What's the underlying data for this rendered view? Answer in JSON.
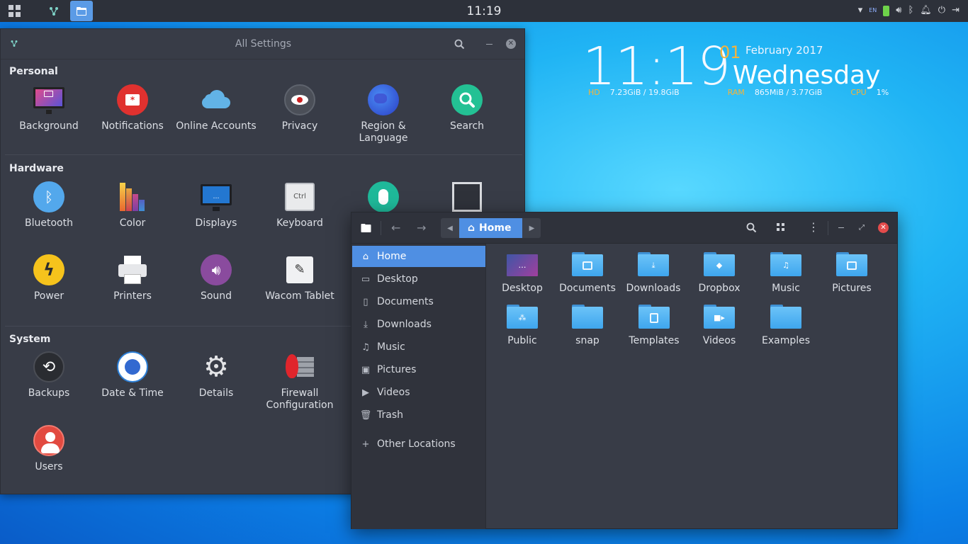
{
  "topbar": {
    "clock": "11:19",
    "lang": "EN"
  },
  "widget": {
    "time": "11:19",
    "day": "01",
    "month_year": "February 2017",
    "weekday": "Wednesday",
    "stats": [
      {
        "key": "HD",
        "value": "7.23GiB / 19.8GiB"
      },
      {
        "key": "RAM",
        "value": "865MiB / 3.77GiB"
      },
      {
        "key": "CPU",
        "value": "1%"
      }
    ]
  },
  "settings": {
    "title": "All Settings",
    "sections": {
      "personal": "Personal",
      "hardware": "Hardware",
      "system": "System"
    },
    "personal": [
      "Background",
      "Notifications",
      "Online Accounts",
      "Privacy",
      "Region & Language",
      "Search"
    ],
    "hardware": [
      "Bluetooth",
      "Color",
      "Displays",
      "Keyboard",
      "Power",
      "Printers",
      "Sound",
      "Wacom Tablet"
    ],
    "system": [
      "Backups",
      "Date & Time",
      "Details",
      "Firewall Configuration",
      "Users"
    ],
    "keyboard_key": "Ctrl"
  },
  "files": {
    "breadcrumb": "Home",
    "sidebar": [
      "Home",
      "Desktop",
      "Documents",
      "Downloads",
      "Music",
      "Pictures",
      "Videos",
      "Trash",
      "Other Locations"
    ],
    "folders": [
      "Desktop",
      "Documents",
      "Downloads",
      "Dropbox",
      "Music",
      "Pictures",
      "Public",
      "snap",
      "Templates",
      "Videos",
      "Examples"
    ]
  },
  "colors": {
    "accent": "#4f8fe3",
    "panel": "#2d313a",
    "window": "#383c47",
    "widget_highlight": "#f5b33a"
  }
}
